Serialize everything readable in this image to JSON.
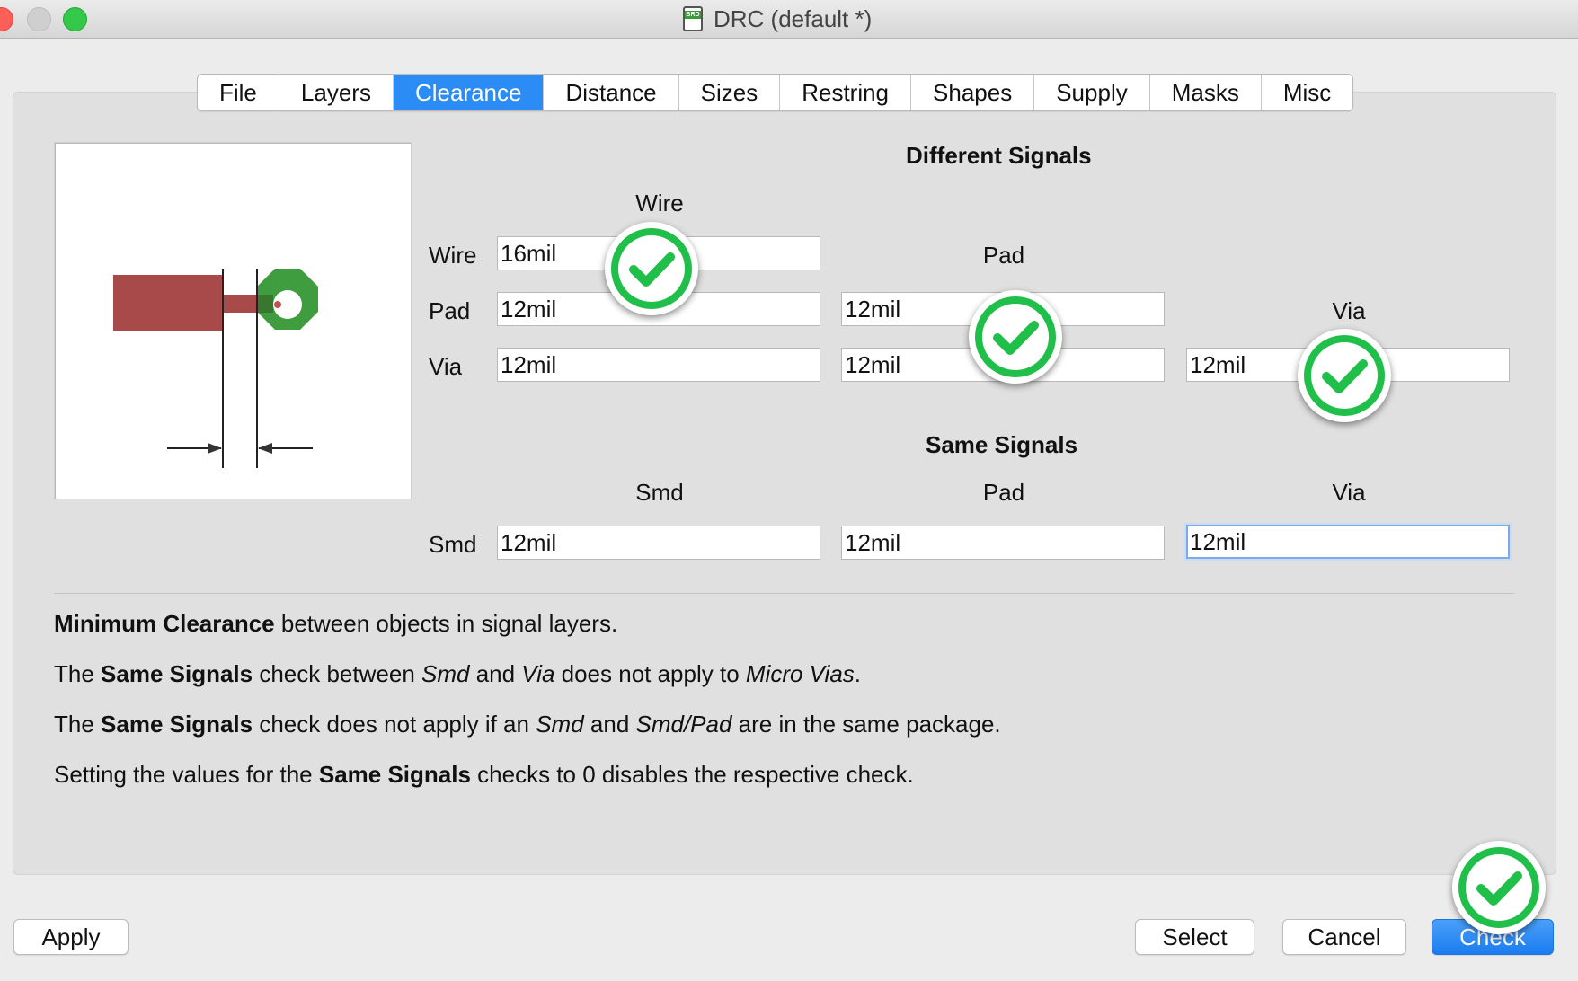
{
  "window": {
    "title": "DRC (default *)"
  },
  "tabs": [
    "File",
    "Layers",
    "Clearance",
    "Distance",
    "Sizes",
    "Restring",
    "Shapes",
    "Supply",
    "Masks",
    "Misc"
  ],
  "active_tab": "Clearance",
  "different": {
    "heading": "Different Signals",
    "col_wire": "Wire",
    "col_pad": "Pad",
    "col_via": "Via",
    "row_wire": "Wire",
    "row_pad": "Pad",
    "row_via": "Via",
    "wire_wire": "16mil",
    "pad_wire": "12mil",
    "pad_pad": "12mil",
    "via_wire": "12mil",
    "via_pad": "12mil",
    "via_via": "12mil"
  },
  "same": {
    "heading": "Same Signals",
    "col_smd": "Smd",
    "col_pad": "Pad",
    "col_via": "Via",
    "row_smd": "Smd",
    "smd_smd": "12mil",
    "smd_pad": "12mil",
    "smd_via": "12mil"
  },
  "info": {
    "l1_b1": "Minimum Clearance",
    "l1_t1": " between objects in signal layers.",
    "l2_t1": "The ",
    "l2_b1": "Same Signals",
    "l2_t2": " check between ",
    "l2_i1": "Smd",
    "l2_t3": " and ",
    "l2_i2": "Via",
    "l2_t4": " does not apply to ",
    "l2_i3": "Micro Vias",
    "l2_t5": ".",
    "l3_t1": "The ",
    "l3_b1": "Same Signals",
    "l3_t2": " check does not apply if an ",
    "l3_i1": "Smd",
    "l3_t3": " and ",
    "l3_i2": "Smd/Pad",
    "l3_t4": " are in the same package.",
    "l4_t1": "Setting the values for the ",
    "l4_b1": "Same Signals",
    "l4_t2": " checks to 0 disables the respective check."
  },
  "buttons": {
    "apply": "Apply",
    "select": "Select",
    "cancel": "Cancel",
    "check": "Check"
  },
  "icons": {
    "app": "brd-file-icon",
    "check_badge": "check-circle-icon"
  },
  "colors": {
    "accent": "#2b8cf5",
    "badge_green": "#1fbf4a",
    "wire": "#a94a4a",
    "pad": "#3f9c3f"
  }
}
